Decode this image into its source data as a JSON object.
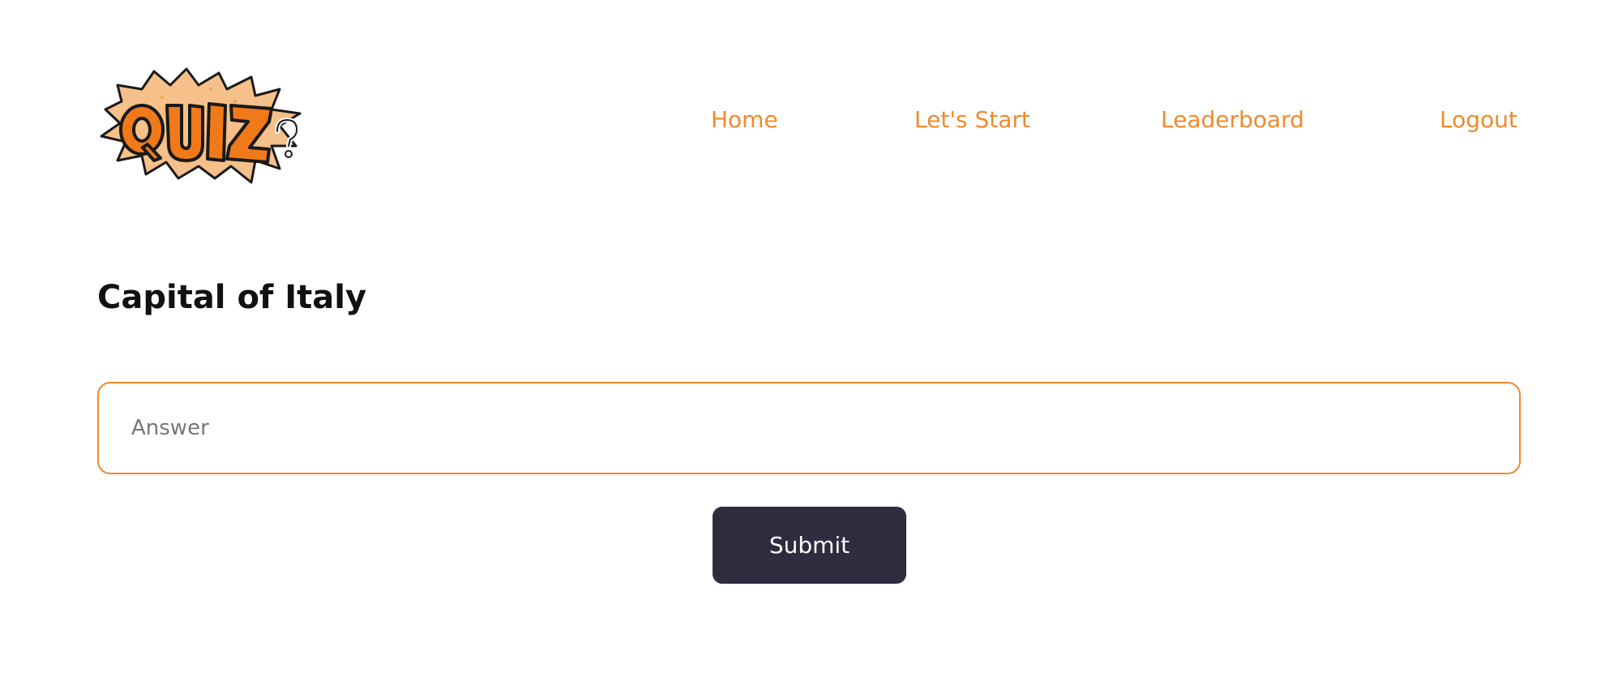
{
  "header": {
    "logo_text": "QUIZ?",
    "nav": [
      {
        "label": "Home"
      },
      {
        "label": "Let's Start"
      },
      {
        "label": "Leaderboard"
      },
      {
        "label": "Logout"
      }
    ]
  },
  "main": {
    "question": "Capital of Italy",
    "answer_field": {
      "placeholder": "Answer",
      "value": ""
    },
    "submit_label": "Submit"
  },
  "colors": {
    "accent": "#f08a2c",
    "button_bg": "#2e2c3e",
    "text": "#111111"
  }
}
